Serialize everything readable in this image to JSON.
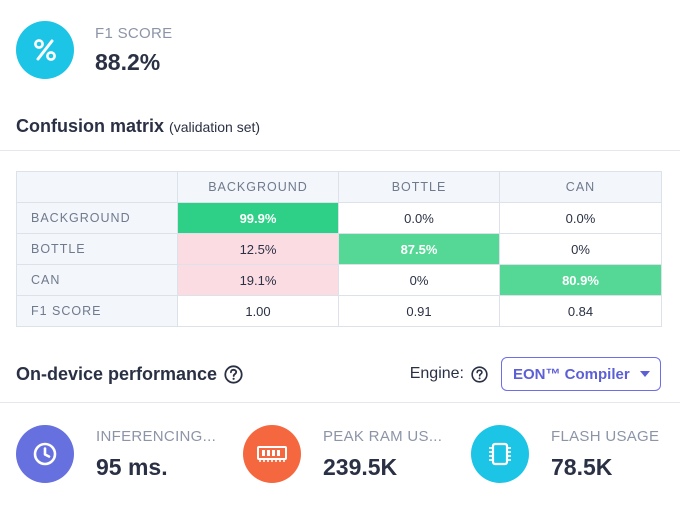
{
  "f1": {
    "icon": "percent-icon",
    "label": "F1 SCORE",
    "value": "88.2%",
    "color": "#1cc4e6"
  },
  "confusion": {
    "title": "Confusion matrix",
    "subtitle": "(validation set)",
    "columns": [
      "BACKGROUND",
      "BOTTLE",
      "CAN"
    ],
    "rows": [
      {
        "label": "BACKGROUND",
        "cells": [
          "99.9%",
          "0.0%",
          "0.0%"
        ]
      },
      {
        "label": "BOTTLE",
        "cells": [
          "12.5%",
          "87.5%",
          "0%"
        ]
      },
      {
        "label": "CAN",
        "cells": [
          "19.1%",
          "0%",
          "80.9%"
        ]
      },
      {
        "label": "F1 SCORE",
        "cells": [
          "1.00",
          "0.91",
          "0.84"
        ]
      }
    ],
    "colors": {
      "diag_strong": "#2ecf86",
      "diag_mid": "#55d896",
      "error": "#fcdce3"
    }
  },
  "performance": {
    "title": "On-device performance",
    "engine_label": "Engine:",
    "engine_value": "EON™ Compiler",
    "metrics": [
      {
        "icon": "clock-icon",
        "label": "INFERENCING...",
        "value": "95 ms.",
        "color": "#6670df"
      },
      {
        "icon": "memory-icon",
        "label": "PEAK RAM US...",
        "value": "239.5K",
        "color": "#f5683f"
      },
      {
        "icon": "chip-icon",
        "label": "FLASH USAGE",
        "value": "78.5K",
        "color": "#1cc4e6"
      }
    ]
  }
}
